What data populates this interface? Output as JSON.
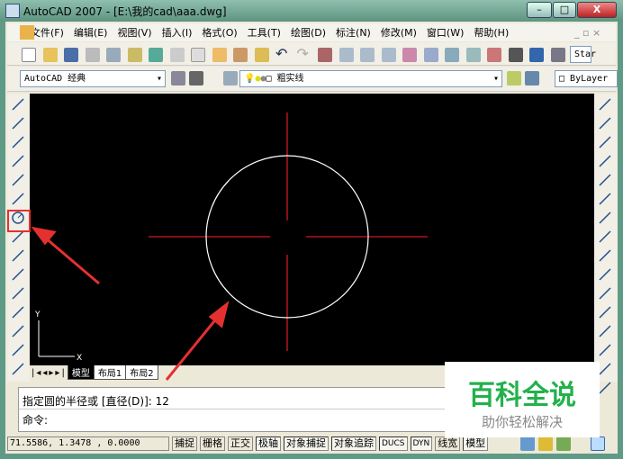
{
  "window": {
    "title": "AutoCAD 2007 - [E:\\我的cad\\aaa.dwg]",
    "minimize": "–",
    "maximize": "□",
    "close": "X"
  },
  "menu": [
    "文件(F)",
    "编辑(E)",
    "视图(V)",
    "插入(I)",
    "格式(O)",
    "工具(T)",
    "绘图(D)",
    "标注(N)",
    "修改(M)",
    "窗口(W)",
    "帮助(H)"
  ],
  "toolbar": {
    "workspace": "AutoCAD 经典",
    "layer": "粗实线",
    "color": "ByLayer",
    "style": "Star"
  },
  "layout_tabs": [
    "模型",
    "布局1",
    "布局2"
  ],
  "ucs": {
    "y": "Y",
    "x": "X"
  },
  "command": {
    "history": "指定圆的半径或 [直径(D)]: 12",
    "prompt": "命令:"
  },
  "status": {
    "coords": "71.5586, 1.3478 , 0.0000",
    "toggles": [
      {
        "label": "捕捉",
        "on": false
      },
      {
        "label": "栅格",
        "on": false
      },
      {
        "label": "正交",
        "on": false
      },
      {
        "label": "极轴",
        "on": true
      },
      {
        "label": "对象捕捉",
        "on": true
      },
      {
        "label": "对象追踪",
        "on": true
      },
      {
        "label": "DUCS",
        "on": true
      },
      {
        "label": "DYN",
        "on": true
      },
      {
        "label": "线宽",
        "on": false
      },
      {
        "label": "模型",
        "on": true
      }
    ]
  },
  "watermark": {
    "title": "百科全说",
    "subtitle": "助你轻松解决"
  },
  "colors": {
    "highlight": "#e53030",
    "circle": "#ffffff",
    "centerline": "#d01818",
    "watermark": "#22b14c"
  }
}
